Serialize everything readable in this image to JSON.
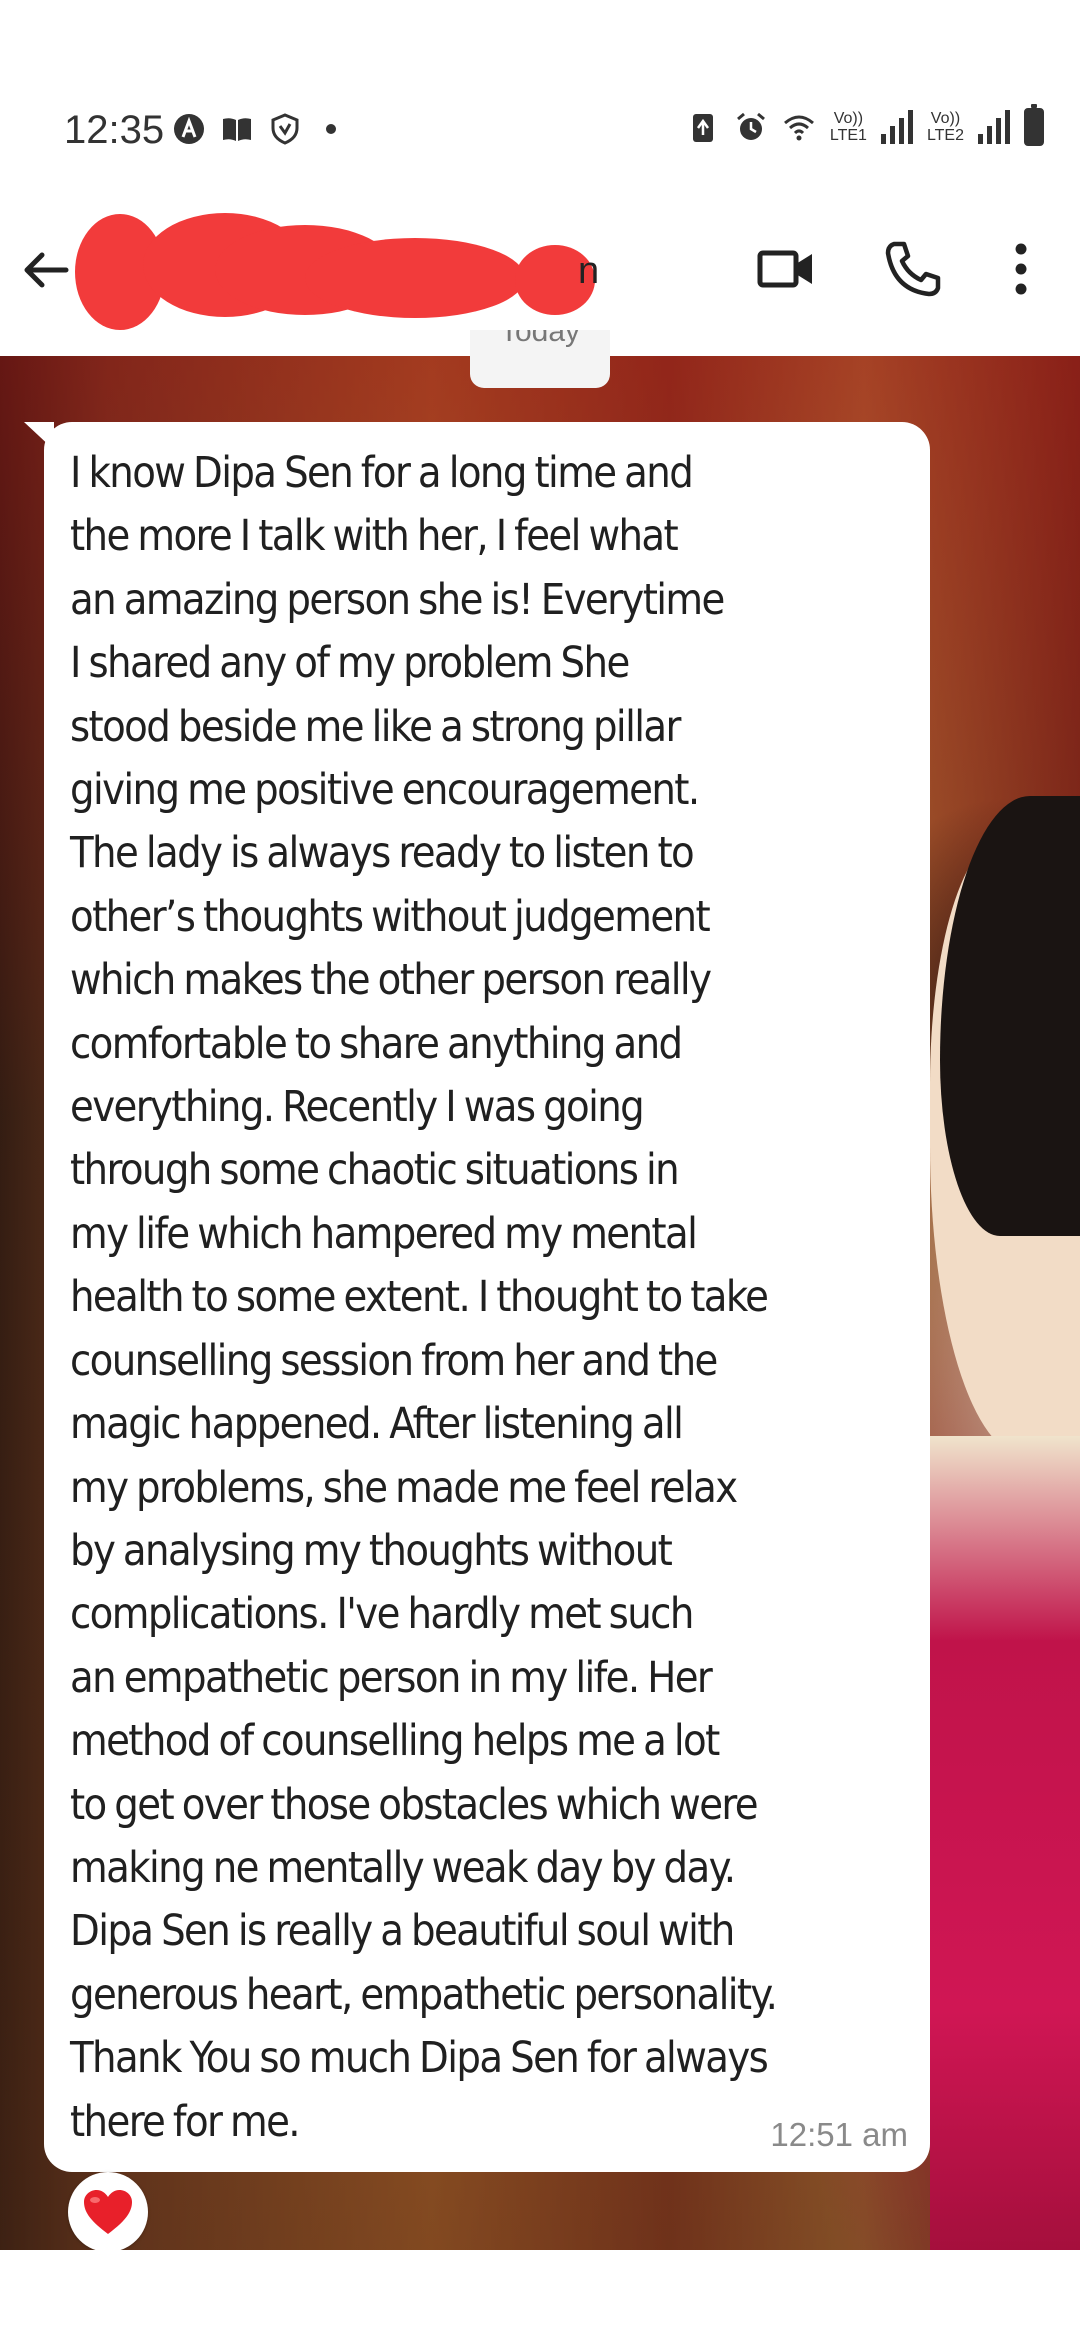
{
  "status_bar": {
    "time": "12:35",
    "sim1_label_top": "Vo))",
    "sim1_label_bottom": "LTE1",
    "sim2_label_top": "Vo))",
    "sim2_label_bottom": "LTE2",
    "left_icons": [
      "a-circle-icon",
      "book-icon",
      "shield-icon",
      "dot-icon"
    ],
    "right_icons": [
      "battery-saver-icon",
      "alarm-icon",
      "wifi-icon",
      "signal-icon",
      "signal-icon",
      "battery-icon"
    ]
  },
  "header": {
    "contact_name_visible": "n",
    "contact_name_redacted": true,
    "redaction_color": "#f23b3b",
    "icons": [
      "back-arrow-icon",
      "video-call-icon",
      "phone-call-icon",
      "more-vert-icon"
    ]
  },
  "chat": {
    "date_separator": "Today",
    "message": {
      "lines": [
        "I know Dipa Sen for a long time and",
        "the more I talk with her,  I feel what",
        "an amazing person she is! Everytime",
        "I shared any of my problem  She",
        "stood beside me like a strong pillar",
        "giving me positive encouragement.",
        "The lady is always ready to listen to",
        "other’s  thoughts without judgement",
        "which makes the other person really",
        "comfortable to share anything and",
        "everything.  Recently I was going",
        "through some chaotic situations in",
        "my life which hampered my mental",
        "health to some extent. I thought to take",
        "counselling session from her and the",
        "magic happened. After listening all",
        "my problems, she made me feel relax",
        "by analysing my thoughts without",
        "complications. I've hardly met such",
        "an empathetic person in my life. Her",
        "method of counselling helps me a lot",
        "to get over those obstacles which were",
        "making ne mentally weak day by day.",
        "Dipa Sen is really a beautiful soul with",
        "generous heart, empathetic personality.",
        "Thank You so much Dipa Sen for always",
        "there for me."
      ],
      "time": "12:51 am"
    },
    "reaction": {
      "emoji": "❤️",
      "icon": "heart-icon",
      "color": "#e8202a"
    }
  }
}
